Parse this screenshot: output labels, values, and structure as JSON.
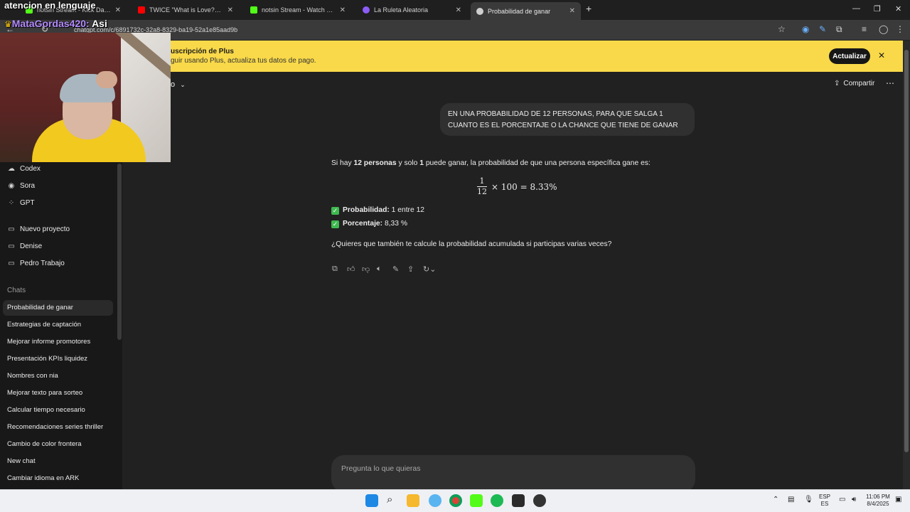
{
  "browser": {
    "tabs": [
      {
        "title": "notsin Stream - Kick Dashboard",
        "favicon_color": "#53fc18"
      },
      {
        "title": "TWICE \"What is Love?\" M/V",
        "favicon_color": "#ff0000"
      },
      {
        "title": "notsin Stream - Watch Live on Kick",
        "favicon_color": "#53fc18"
      },
      {
        "title": "La Ruleta Aleatoria",
        "favicon_color": "#8b5cf6"
      },
      {
        "title": "Probabilidad de ganar",
        "favicon_color": "#cfcfcf"
      }
    ],
    "url": "chatgpt.com/c/6891732c-32a8-8329-ba19-52a1e85aad9b"
  },
  "banner": {
    "title": "uscripción de Plus",
    "subtitle": "guir usando Plus, actualiza tus datos de pago.",
    "button": "Actualizar"
  },
  "header": {
    "model_fragment": "o",
    "share_label": "Compartir"
  },
  "sidebar": {
    "tools": [
      {
        "label": "Codex",
        "icon": "cloud-icon"
      },
      {
        "label": "Sora",
        "icon": "play-circle-icon"
      },
      {
        "label": "GPT",
        "icon": "grid-icon"
      }
    ],
    "projects": [
      {
        "label": "Nuevo proyecto",
        "icon": "folder-plus-icon"
      },
      {
        "label": "Denise",
        "icon": "folder-icon"
      },
      {
        "label": "Pedro Trabajo",
        "icon": "folder-icon"
      }
    ],
    "chats_label": "Chats",
    "chats": [
      "Probabilidad de ganar",
      "Estrategias de captación",
      "Mejorar informe promotores",
      "Presentación KPIs liquidez",
      "Nombres con nia",
      "Mejorar texto para sorteo",
      "Calcular tiempo necesario",
      "Recomendaciones series thriller",
      "Cambio de color frontera",
      "New chat",
      "Cambiar idioma en ARK"
    ]
  },
  "conversation": {
    "user_message_line1": "EN UNA PROBABILIDAD DE 12 PERSONAS, PARA QUE SALGA 1",
    "user_message_line2": "CUANTO ES EL PORCENTAJE O LA CHANCE QUE TIENE DE GANAR",
    "answer": {
      "p1_a": "Si hay ",
      "p1_b": "12 personas",
      "p1_c": " y solo ",
      "p1_d": "1",
      "p1_e": " puede ganar, la probabilidad de que una persona específica gane es:",
      "math_num": "1",
      "math_den": "12",
      "math_rest": "× 100 = 8.33%",
      "bullet1_label": "Probabilidad:",
      "bullet1_value": " 1 entre 12",
      "bullet2_label": "Porcentaje:",
      "bullet2_value": " 8,33 %",
      "question": "¿Quieres que también te calcule la probabilidad acumulada si participas varias veces?"
    }
  },
  "composer": {
    "placeholder": "Pregunta lo que quieras"
  },
  "stream_overlay": {
    "top_text": "atencion en lenguaje",
    "username": "MataGordas420:",
    "message": " Asi"
  },
  "taskbar": {
    "lang_line1": "ESP",
    "lang_line2": "ES",
    "time": "11:06 PM",
    "date": "8/4/2025"
  }
}
